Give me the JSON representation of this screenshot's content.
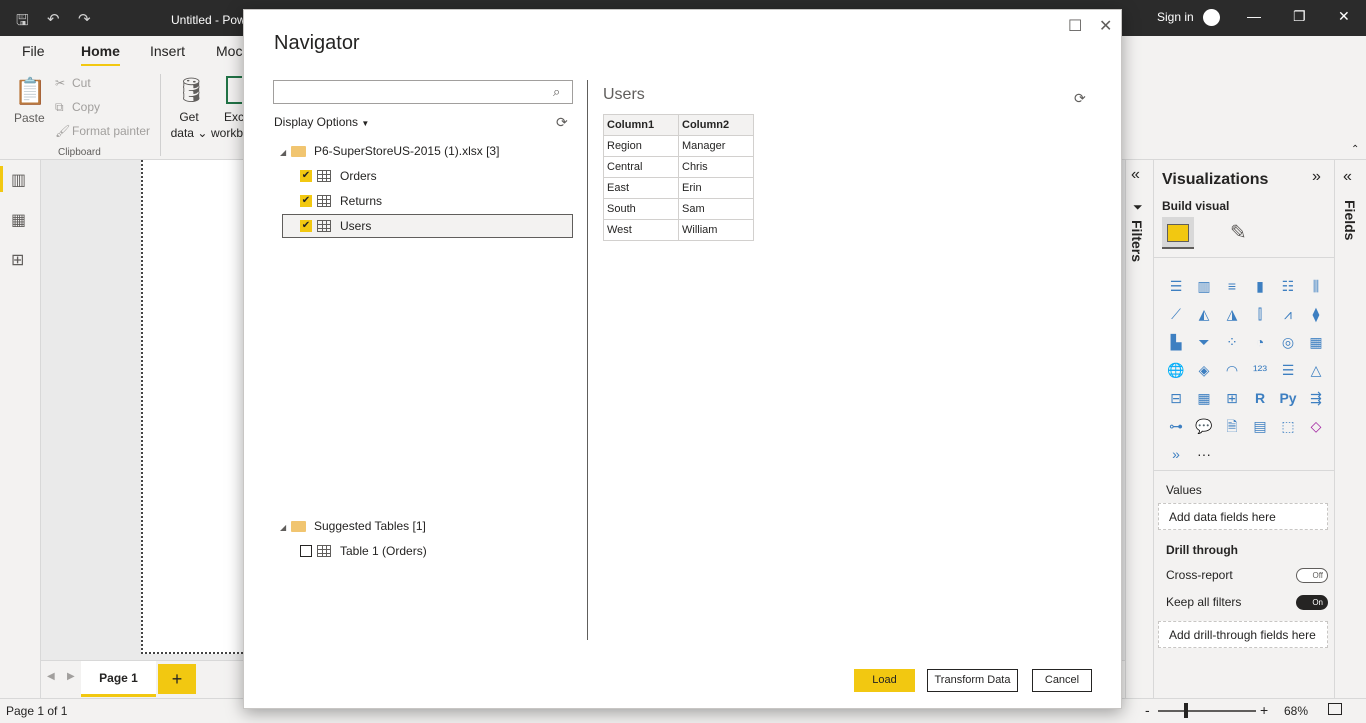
{
  "app": {
    "title": "Untitled - Pow",
    "sign_in": "Sign in"
  },
  "ribbon_tabs": [
    {
      "label": "File"
    },
    {
      "label": "Home"
    },
    {
      "label": "Insert"
    },
    {
      "label": "Moc"
    }
  ],
  "ribbon": {
    "paste": "Paste",
    "cut": "Cut",
    "copy": "Copy",
    "format_painter": "Format painter",
    "clipboard": "Clipboard",
    "get_data_1": "Get",
    "get_data_2": "data ⌄",
    "excel_1": "Exc",
    "excel_2": "workb"
  },
  "pages": {
    "page1": "Page 1",
    "add": "+"
  },
  "status": {
    "page_of": "Page 1 of 1",
    "zoom": "68%"
  },
  "filters": {
    "label": "Filters"
  },
  "fields": {
    "label": "Fields"
  },
  "visualizations": {
    "title": "Visualizations",
    "build_visual": "Build visual",
    "values_label": "Values",
    "values_placeholder": "Add data fields here",
    "drill_through": "Drill through",
    "cross_report": "Cross-report",
    "cross_report_state": "Off",
    "keep_all_filters": "Keep all filters",
    "keep_all_filters_state": "On",
    "drill_placeholder": "Add drill-through fields here",
    "more": "···"
  },
  "navigator": {
    "title": "Navigator",
    "search_value": "",
    "display_options": "Display Options",
    "tree": {
      "file_node": "P6-SuperStoreUS-2015 (1).xlsx [3]",
      "items": [
        {
          "label": "Orders",
          "checked": true
        },
        {
          "label": "Returns",
          "checked": true
        },
        {
          "label": "Users",
          "checked": true
        }
      ],
      "suggested_node": "Suggested Tables [1]",
      "suggested_items": [
        {
          "label": "Table 1 (Orders)",
          "checked": false
        }
      ]
    },
    "preview": {
      "title": "Users",
      "columns": [
        "Column1",
        "Column2"
      ],
      "rows": [
        [
          "Region",
          "Manager"
        ],
        [
          "Central",
          "Chris"
        ],
        [
          "East",
          "Erin"
        ],
        [
          "South",
          "Sam"
        ],
        [
          "West",
          "William"
        ]
      ]
    },
    "buttons": {
      "load": "Load",
      "transform": "Transform Data",
      "cancel": "Cancel"
    }
  }
}
